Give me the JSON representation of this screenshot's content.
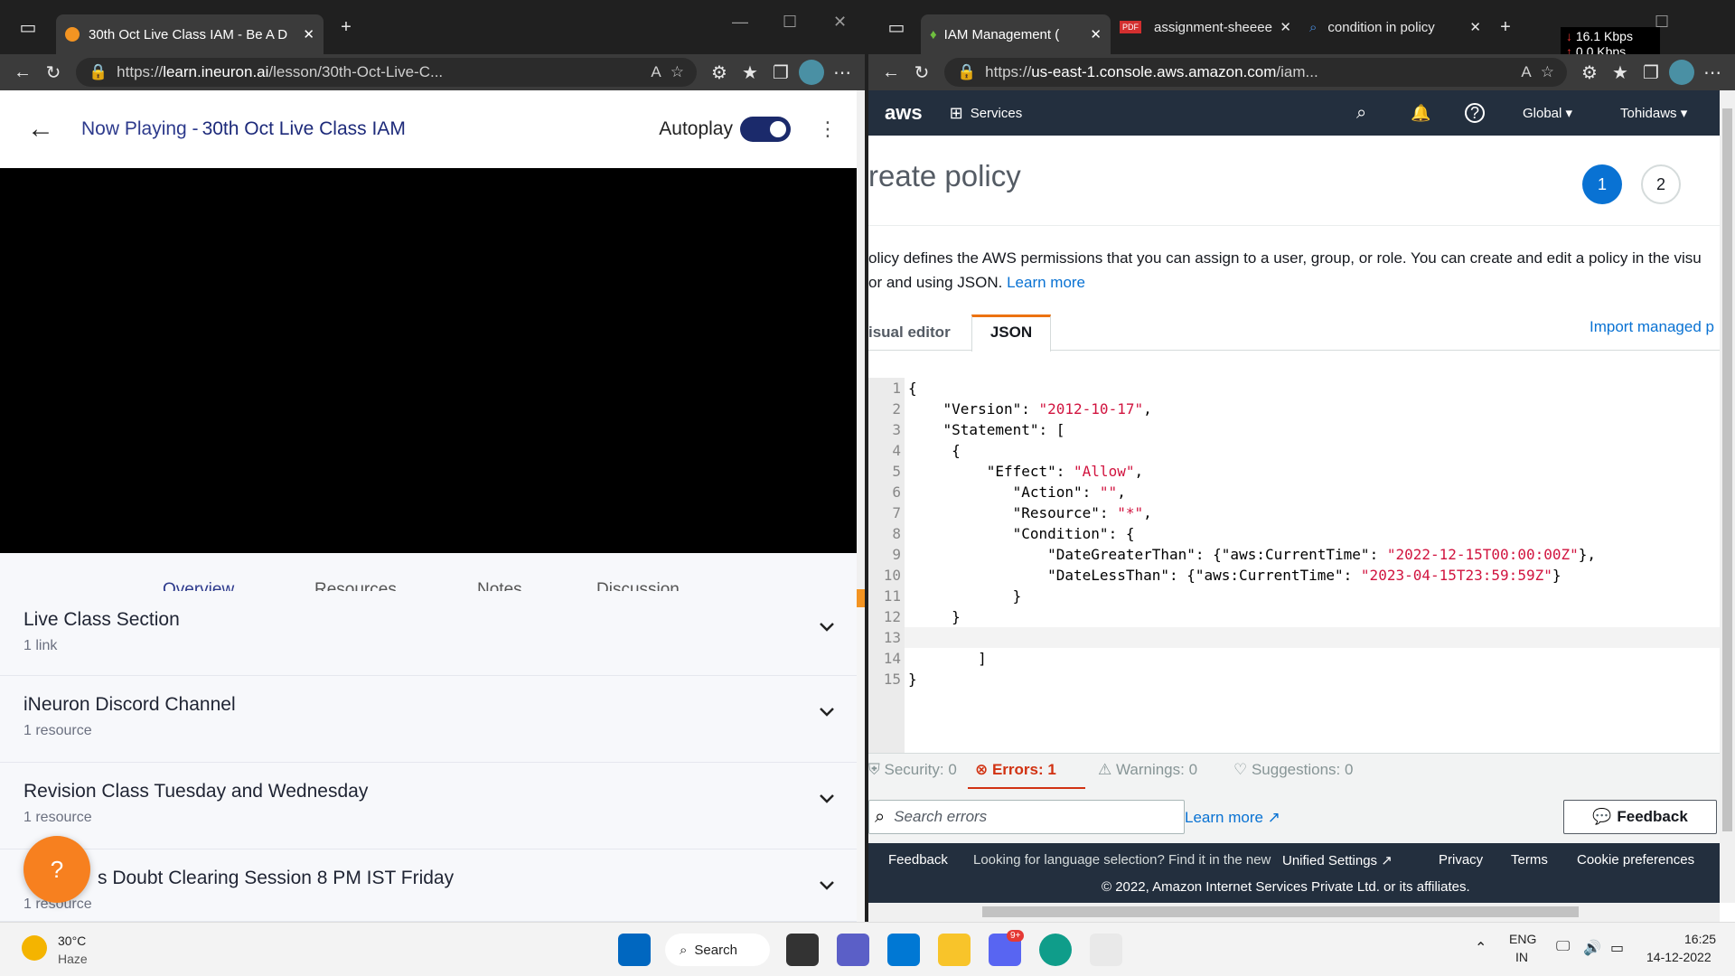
{
  "left_browser": {
    "tab_title": "30th Oct Live Class IAM - Be A D",
    "url_prefix": "https://",
    "url_host": "learn.ineuron.ai",
    "url_rest": "/lesson/30th-Oct-Live-C...",
    "now_playing_label": "Now Playing - ",
    "now_playing_title": "30th Oct Live Class IAM",
    "autoplay_label": "Autoplay",
    "tabs": [
      "Overview",
      "Resources",
      "Notes",
      "Discussion"
    ],
    "sections": [
      {
        "title": "Live Class Section",
        "sub": "1 link"
      },
      {
        "title": "iNeuron Discord Channel",
        "sub": "1 resource"
      },
      {
        "title": "Revision Class Tuesday and Wednesday",
        "sub": "1 resource"
      },
      {
        "title": "s Doubt Clearing Session 8 PM IST Friday",
        "sub": "1 resource"
      }
    ]
  },
  "right_browser": {
    "tabs": [
      "IAM Management (",
      "assignment-sheeee",
      "condition in policy"
    ],
    "url_prefix": "https://",
    "url_host": "us-east-1.console.aws.amazon.com",
    "url_rest": "/iam...",
    "net_down": "16.1 Kbps",
    "net_up": "0.0 Kbps",
    "nav": {
      "logo": "aws",
      "services": "Services",
      "region": "Global",
      "account": "Tohidaws"
    },
    "page_title": "reate policy",
    "steps": [
      "1",
      "2"
    ],
    "desc_line1": "olicy defines the AWS permissions that you can assign to a user, group, or role. You can create and edit a policy in the visu",
    "desc_line2": "or and using JSON. ",
    "learn_more": "Learn more",
    "editor_tabs": [
      "isual editor",
      "JSON"
    ],
    "import_link": "Import managed p",
    "code_lines": [
      "{",
      "    \"Version\": \"2012-10-17\",",
      "    \"Statement\": [",
      "     {",
      "         \"Effect\": \"Allow\",",
      "            \"Action\": \"\",",
      "            \"Resource\": \"*\",",
      "            \"Condition\": {",
      "                \"DateGreaterThan\": {\"aws:CurrentTime\": \"2022-12-15T00:00:00Z\"},",
      "                \"DateLessThan\": {\"aws:CurrentTime\": \"2023-04-15T23:59:59Z\"}",
      "            }",
      "     }",
      "",
      "        ]",
      "}"
    ],
    "status": {
      "security": "Security: 0",
      "errors": "Errors: 1",
      "warnings": "Warnings: 0",
      "suggestions": "Suggestions: 0"
    },
    "search_placeholder": "Search errors",
    "learn_more_ext": "Learn more",
    "feedback_btn": "Feedback",
    "footer": {
      "feedback": "Feedback",
      "lang_text": "Looking for language selection? Find it in the new",
      "unified": "Unified Settings",
      "privacy": "Privacy",
      "terms": "Terms",
      "cookie": "Cookie preferences",
      "copyright": "© 2022, Amazon Internet Services Private Ltd. or its affiliates."
    }
  },
  "taskbar": {
    "temp": "30°C",
    "weather": "Haze",
    "search": "Search",
    "lang1": "ENG",
    "lang2": "IN",
    "time": "16:25",
    "date": "14-12-2022",
    "badge": "9+"
  }
}
